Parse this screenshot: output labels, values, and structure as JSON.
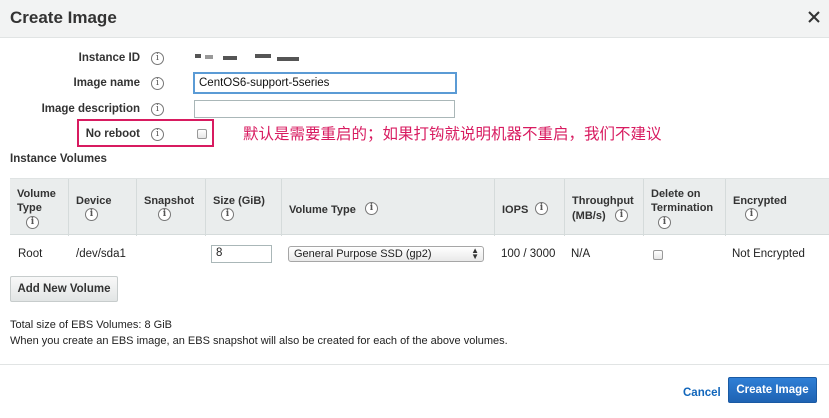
{
  "dialog": {
    "title": "Create Image"
  },
  "form": {
    "instance_id_label": "Instance ID",
    "image_name_label": "Image name",
    "image_name_value": "CentOS6-support-5series",
    "image_description_label": "Image description",
    "image_description_value": "",
    "no_reboot_label": "No reboot",
    "no_reboot_checked": false,
    "info_glyph": "i"
  },
  "annotation": {
    "text": "默认是需要重启的；如果打钩就说明机器不重启，我们不建议"
  },
  "volumes": {
    "section_title": "Instance Volumes",
    "columns": [
      {
        "label_lines": [
          "Volume",
          "Type"
        ],
        "info": true
      },
      {
        "label_lines": [
          "Device"
        ],
        "info": true
      },
      {
        "label_lines": [
          "Snapshot"
        ],
        "info": true
      },
      {
        "label_lines": [
          "Size (GiB)"
        ],
        "info": true
      },
      {
        "label_lines": [
          "Volume Type"
        ],
        "info": true
      },
      {
        "label_lines": [
          "IOPS"
        ],
        "info": true
      },
      {
        "label_lines": [
          "Throughput",
          "(MB/s)"
        ],
        "info": true
      },
      {
        "label_lines": [
          "Delete on",
          "Termination"
        ],
        "info": true
      },
      {
        "label_lines": [
          "Encrypted"
        ],
        "info": true
      }
    ],
    "row": {
      "volume_type": "Root",
      "device": "/dev/sda1",
      "snapshot": "",
      "size": "8",
      "volume_type_select": "General Purpose SSD (gp2)",
      "iops": "100 / 3000",
      "throughput": "N/A",
      "delete_on_termination": false,
      "encrypted": "Not Encrypted"
    },
    "add_button": "Add New Volume"
  },
  "notes": {
    "total_size": "Total size of EBS Volumes: 8 GiB",
    "snapshot_note": "When you create an EBS image, an EBS snapshot will also be created for each of the above volumes."
  },
  "footer": {
    "cancel": "Cancel",
    "create": "Create Image"
  },
  "colors": {
    "accent": "#1f63b3",
    "annotation": "#d81b60",
    "focus": "#5b9bd5",
    "header_bg": "#f2f3f3"
  }
}
